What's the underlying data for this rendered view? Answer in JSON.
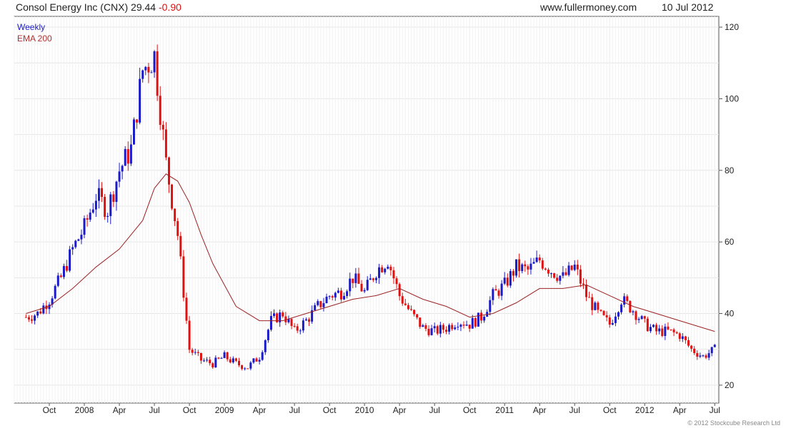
{
  "header": {
    "title": "Consol Energy Inc (CNX) 29.44",
    "change": "-0.90",
    "website": "www.fullermoney.com",
    "date": "10 Jul 2012"
  },
  "legend": {
    "weekly": "Weekly",
    "ema": "EMA 200"
  },
  "copyright": "© 2012 Stockcube Research Ltd",
  "colors": {
    "up": "#1a1ac8",
    "down": "#e01010",
    "ema": "#9b2222",
    "grid": "#e4e4e4"
  },
  "chart_data": {
    "type": "candlestick",
    "title": "Consol Energy Inc (CNX)",
    "series": [
      {
        "name": "Weekly",
        "kind": "weekly close (approx.)",
        "x": [
          "2007-08",
          "2007-09",
          "2007-10",
          "2007-11",
          "2007-12",
          "2008-01",
          "2008-02",
          "2008-03",
          "2008-04",
          "2008-05",
          "2008-06",
          "2008-07",
          "2008-08",
          "2008-09",
          "2008-10",
          "2008-11",
          "2008-12",
          "2009-01",
          "2009-02",
          "2009-03",
          "2009-04",
          "2009-05",
          "2009-06",
          "2009-07",
          "2009-08",
          "2009-09",
          "2009-10",
          "2009-11",
          "2009-12",
          "2010-01",
          "2010-02",
          "2010-03",
          "2010-04",
          "2010-05",
          "2010-06",
          "2010-07",
          "2010-08",
          "2010-09",
          "2010-10",
          "2010-11",
          "2010-12",
          "2011-01",
          "2011-02",
          "2011-03",
          "2011-04",
          "2011-05",
          "2011-06",
          "2011-07",
          "2011-08",
          "2011-09",
          "2011-10",
          "2011-11",
          "2011-12",
          "2012-01",
          "2012-02",
          "2012-03",
          "2012-04",
          "2012-05",
          "2012-06",
          "2012-07"
        ],
        "y": [
          39,
          40,
          44,
          50,
          58,
          64,
          73,
          69,
          80,
          86,
          108,
          112,
          82,
          62,
          30,
          27,
          26,
          28,
          26,
          25,
          28,
          38,
          40,
          35,
          38,
          42,
          45,
          46,
          50,
          46,
          52,
          55,
          45,
          40,
          36,
          35,
          36,
          38,
          37,
          39,
          45,
          48,
          53,
          52,
          55,
          52,
          50,
          53,
          45,
          40,
          37,
          44,
          41,
          37,
          35,
          35,
          34,
          30,
          28,
          30
        ]
      },
      {
        "name": "EMA 200",
        "kind": "line",
        "x": [
          "2007-08",
          "2007-10",
          "2007-12",
          "2008-02",
          "2008-04",
          "2008-06",
          "2008-07",
          "2008-08",
          "2008-09",
          "2008-10",
          "2008-11",
          "2008-12",
          "2009-02",
          "2009-04",
          "2009-06",
          "2009-08",
          "2009-10",
          "2009-12",
          "2010-02",
          "2010-04",
          "2010-06",
          "2010-08",
          "2010-10",
          "2010-12",
          "2011-02",
          "2011-04",
          "2011-06",
          "2011-08",
          "2011-10",
          "2011-12",
          "2012-02",
          "2012-04",
          "2012-06",
          "2012-07"
        ],
        "y": [
          40,
          42,
          47,
          53,
          58,
          66,
          75,
          79,
          77,
          71,
          62,
          54,
          42,
          38,
          38,
          40,
          42,
          44,
          45,
          47,
          44,
          42,
          39,
          40,
          43,
          47,
          47,
          48,
          45,
          42,
          40,
          38,
          36,
          35
        ]
      }
    ],
    "x_ticks": [
      "Oct",
      "2008",
      "Apr",
      "Jul",
      "Oct",
      "2009",
      "Apr",
      "Jul",
      "Oct",
      "2010",
      "Apr",
      "Jul",
      "Oct",
      "2011",
      "Apr",
      "Jul",
      "Oct",
      "2012",
      "Apr",
      "Jul"
    ],
    "y_ticks": [
      20,
      40,
      60,
      80,
      100,
      120
    ],
    "ylim": [
      15,
      123
    ],
    "xlim": [
      "2007-07",
      "2012-07"
    ],
    "y_axis_position": "right",
    "grid": true,
    "legend_position": "top-left"
  }
}
